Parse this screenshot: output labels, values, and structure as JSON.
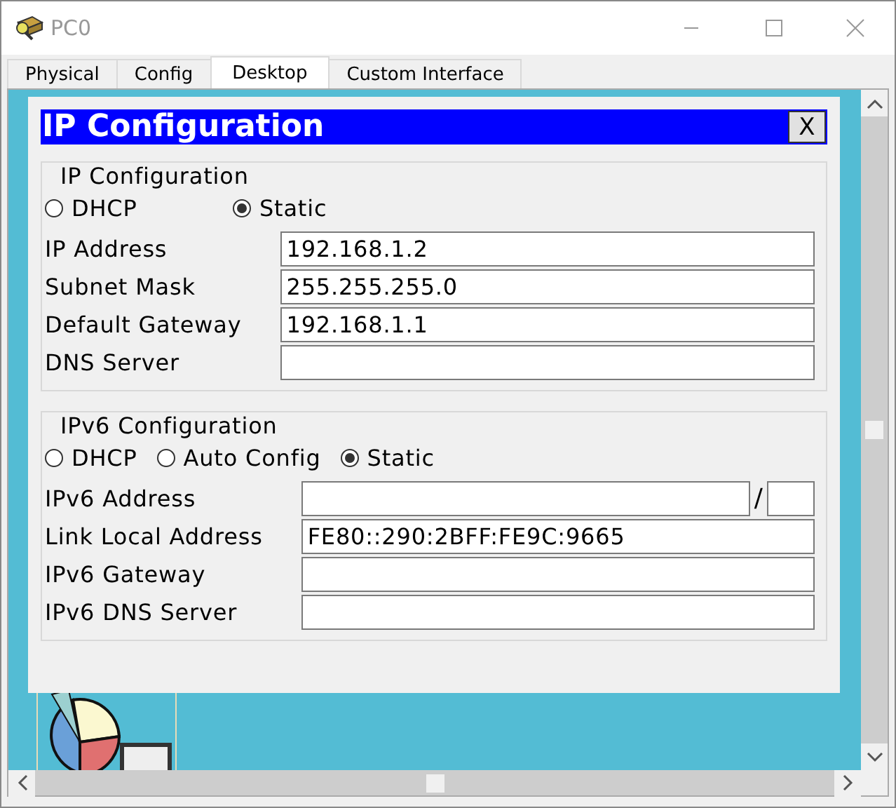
{
  "window": {
    "title": "PC0"
  },
  "tabs": [
    {
      "label": "Physical",
      "selected": false
    },
    {
      "label": "Config",
      "selected": false
    },
    {
      "label": "Desktop",
      "selected": true
    },
    {
      "label": "Custom Interface",
      "selected": false
    }
  ],
  "dialog": {
    "title": "IP Configuration",
    "close": "X",
    "groups": [
      {
        "heading": "IP Configuration",
        "modes": [
          {
            "label": "DHCP",
            "selected": false
          },
          {
            "label": "Static",
            "selected": true
          }
        ],
        "fields": [
          {
            "label": "IP Address",
            "kind": "text",
            "value": "192.168.1.2"
          },
          {
            "label": "Subnet Mask",
            "kind": "text",
            "value": "255.255.255.0"
          },
          {
            "label": "Default Gateway",
            "kind": "text",
            "value": "192.168.1.1"
          },
          {
            "label": "DNS Server",
            "kind": "text"
          }
        ]
      },
      {
        "heading": "IPv6 Configuration",
        "modes": [
          {
            "label": "DHCP",
            "selected": false
          },
          {
            "label": "Auto Config",
            "selected": false
          },
          {
            "label": "Static",
            "selected": true
          }
        ],
        "fields": [
          {
            "label": "IPv6 Address",
            "kind": "prefixed",
            "separator": "/"
          },
          {
            "label": "Link Local Address",
            "kind": "text",
            "value": "FE80::290:2BFF:FE9C:9665"
          },
          {
            "label": "IPv6 Gateway",
            "kind": "text"
          },
          {
            "label": "IPv6 DNS Server",
            "kind": "text"
          }
        ]
      }
    ]
  }
}
